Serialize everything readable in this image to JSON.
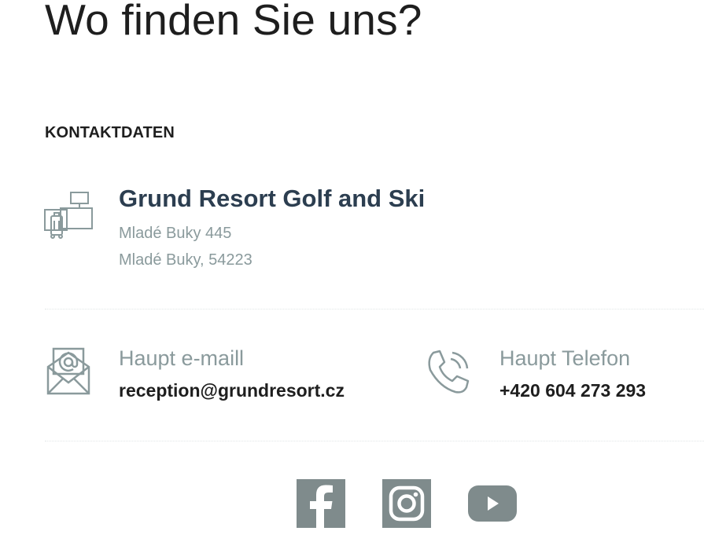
{
  "heading": "Wo finden Sie uns?",
  "section_label": "KONTAKTDATEN",
  "hotel": {
    "name": "Grund Resort Golf and Ski",
    "address_line1": "Mladé Buky 445",
    "address_line2": "Mladé Buky, 54223",
    "icon": "hotel-reception-icon"
  },
  "email": {
    "label": "Haupt e-maill",
    "value": "reception@grundresort.cz",
    "icon": "mail-icon"
  },
  "phone": {
    "label": "Haupt Telefon",
    "value": "+420 604 273 293",
    "icon": "phone-icon"
  },
  "social": [
    {
      "name": "facebook",
      "icon": "facebook-icon"
    },
    {
      "name": "instagram",
      "icon": "instagram-icon"
    },
    {
      "name": "youtube",
      "icon": "youtube-icon"
    }
  ],
  "colors": {
    "icon_gray": "#7f8b8c",
    "hotel_name": "#2c3e50",
    "muted_text": "#8a9a9c",
    "text": "#1e1e1e"
  }
}
